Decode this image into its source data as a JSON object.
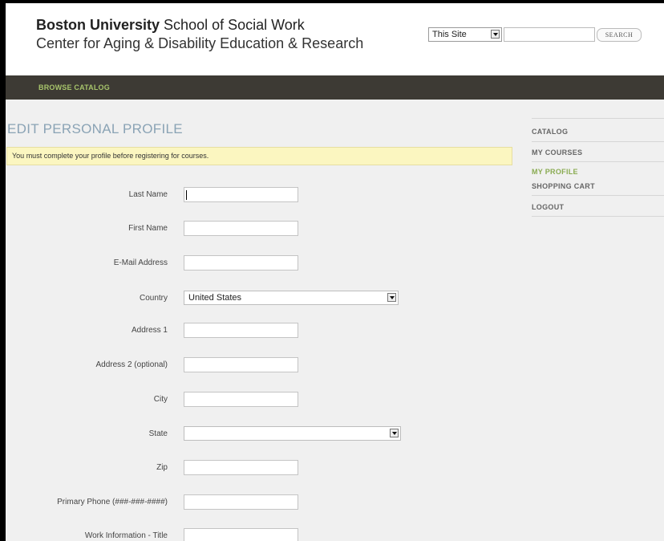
{
  "header": {
    "org_bold": "Boston University",
    "org_rest": "School of Social Work",
    "subtitle": "Center for Aging & Disability Education & Research",
    "site_select_value": "This Site",
    "search_placeholder": "",
    "search_button_label": "SEARCH"
  },
  "nav": {
    "browse_label": "BROWSE CATALOG"
  },
  "main": {
    "title": "EDIT PERSONAL PROFILE",
    "notice": "You must complete your profile before registering for courses.",
    "fields": [
      {
        "label": "Last Name",
        "value": ""
      },
      {
        "label": "First Name",
        "value": ""
      },
      {
        "label": "E-Mail Address",
        "value": ""
      },
      {
        "label": "Country",
        "value": "United States"
      },
      {
        "label": "Address 1",
        "value": ""
      },
      {
        "label": "Address 2 (optional)",
        "value": ""
      },
      {
        "label": "City",
        "value": ""
      },
      {
        "label": "State",
        "value": ""
      },
      {
        "label": "Zip",
        "value": ""
      },
      {
        "label": "Primary Phone (###-###-####)",
        "value": ""
      },
      {
        "label": "Work Information - Title",
        "value": ""
      }
    ]
  },
  "sidebar": {
    "items": [
      {
        "label": "CATALOG"
      },
      {
        "label": "MY COURSES"
      },
      {
        "label": "MY PROFILE"
      },
      {
        "label": "SHOPPING CART"
      },
      {
        "label": "LOGOUT"
      }
    ]
  },
  "colors": {
    "nav_bg": "#3d3a34",
    "nav_text": "#a7c46b",
    "title_color": "#8aa3b5",
    "notice_bg": "#fbf6c0",
    "active_sidebar": "#8aab52"
  }
}
